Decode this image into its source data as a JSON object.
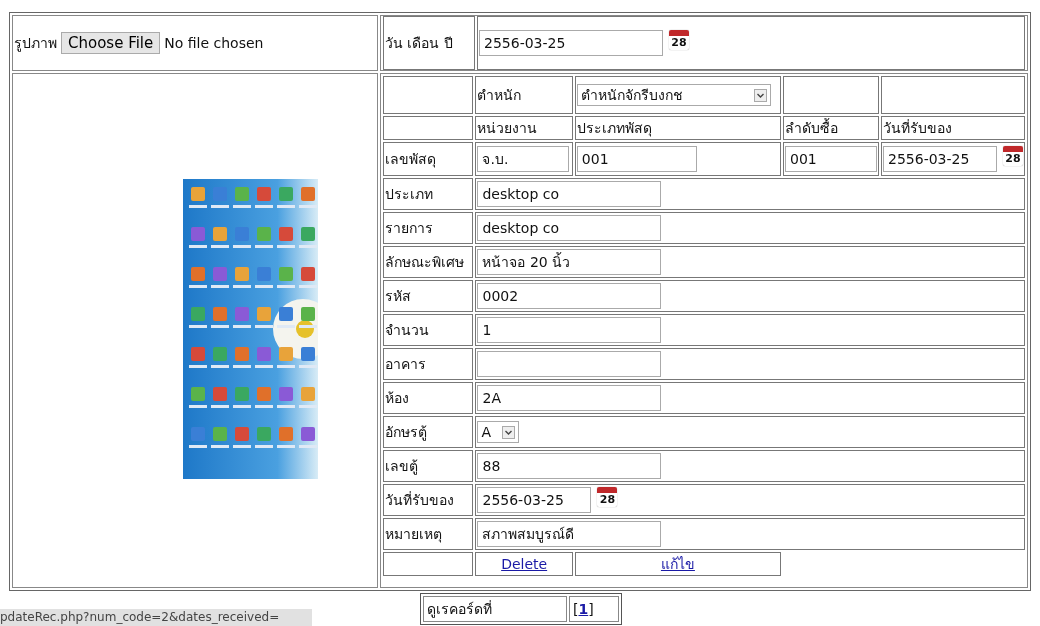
{
  "image_field": {
    "label": "รูปภาพ",
    "button": "Choose File",
    "status": "No file chosen"
  },
  "date_field": {
    "label": "วัน เดือน ปี",
    "value": "2556-03-25",
    "calendar_day": "28"
  },
  "office_row": {
    "label": "ตำหนัก",
    "value": "ตำหนักจักรีบงกช"
  },
  "code_headers": [
    "หน่วยงาน",
    "ประเภทพัสดุ",
    "ลำดับซื้อ",
    "วันที่รับของ"
  ],
  "code_row": {
    "label": "เลขพัสดุ",
    "values": [
      "จ.บ.",
      "001",
      "001",
      "2556-03-25"
    ],
    "calendar_day": "28"
  },
  "fields": [
    {
      "kind": "text",
      "label": "ประเภท",
      "value": "desktop co"
    },
    {
      "kind": "text",
      "label": "รายการ",
      "value": "desktop co"
    },
    {
      "kind": "text",
      "label": "ลักษณะพิเศษ",
      "value": "หน้าจอ 20 นิ้ว"
    },
    {
      "kind": "text",
      "label": "รหัส",
      "value": "0002"
    },
    {
      "kind": "text",
      "label": "จำนวน",
      "value": "1"
    },
    {
      "kind": "text",
      "label": "อาคาร"
    },
    {
      "kind": "text",
      "label": "ห้อง",
      "value": "2A"
    },
    {
      "kind": "select",
      "label": "อักษรตู้",
      "value": "A"
    },
    {
      "kind": "text",
      "label": "เลขตู้",
      "value": "88"
    },
    {
      "kind": "date",
      "label": "วันที่รับของ",
      "value": "2556-03-25",
      "calendar_day": "28"
    },
    {
      "kind": "text",
      "label": "หมายเหตุ",
      "value": "สภาพสมบูรณ์ดี"
    }
  ],
  "actions": [
    "Delete",
    "แก้ไข"
  ],
  "record_nav": {
    "label": "ดูเรคอร์ดที่",
    "open_bracket": "[",
    "page": "1",
    "close_bracket": "]"
  },
  "status_url": "pdateRec.php?num_code=2&dates_received="
}
